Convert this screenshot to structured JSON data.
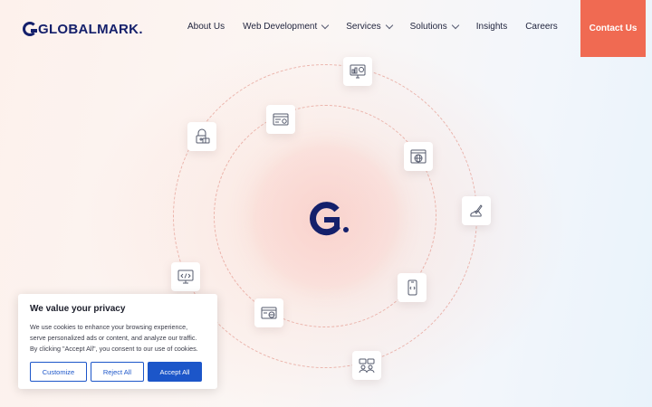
{
  "brand": {
    "name": "GLOBALMARK",
    "color": "#14206b"
  },
  "nav": {
    "items": [
      {
        "label": "About Us",
        "has_dropdown": false
      },
      {
        "label": "Web Development",
        "has_dropdown": true
      },
      {
        "label": "Services",
        "has_dropdown": true
      },
      {
        "label": "Solutions",
        "has_dropdown": true
      },
      {
        "label": "Insights",
        "has_dropdown": false
      },
      {
        "label": "Careers",
        "has_dropdown": false
      }
    ],
    "contact_label": "Contact Us",
    "contact_color": "#f06a52"
  },
  "hero": {
    "core_icon": "globalmark-g-logo",
    "orbit_icons": [
      "analytics-monitor-icon",
      "browser-settings-icon",
      "lock-security-icon",
      "web-globe-icon",
      "rocket-cloud-icon",
      "code-monitor-icon",
      "mobile-code-icon",
      "browser-globe-icon",
      "team-chat-icon"
    ]
  },
  "cookie_banner": {
    "title": "We value your privacy",
    "lines": [
      "We use cookies to enhance your browsing experience,",
      "serve personalized ads or content, and analyze our traffic.",
      "By clicking \"Accept All\", you consent to our use of cookies."
    ],
    "customize_label": "Customize",
    "reject_label": "Reject All",
    "accept_label": "Accept All",
    "accent_color": "#1c56c9"
  }
}
